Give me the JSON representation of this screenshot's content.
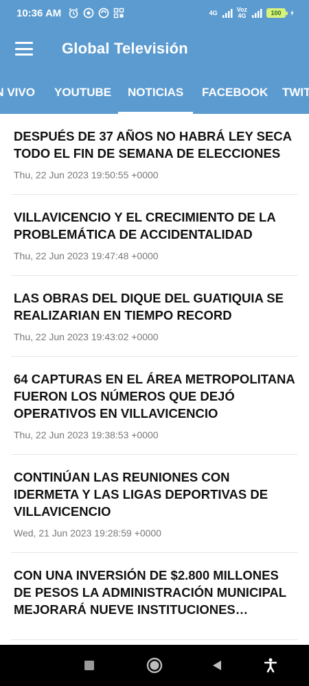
{
  "status_bar": {
    "time": "10:36 AM",
    "network_label_top": "Voz",
    "network_label_bottom": "4G",
    "signal_label": "4G",
    "battery": "100"
  },
  "app_bar": {
    "title": "Global Televisión"
  },
  "tabs": [
    {
      "label": "EN VIVO"
    },
    {
      "label": "YOUTUBE"
    },
    {
      "label": "NOTICIAS",
      "active": true
    },
    {
      "label": "FACEBOOK"
    },
    {
      "label": "TWITTER"
    }
  ],
  "news": [
    {
      "title": "DESPUÉS DE 37 AÑOS NO HABRÁ LEY SECA TODO EL FIN DE SEMANA DE ELECCIONES",
      "date": "Thu, 22 Jun 2023 19:50:55 +0000"
    },
    {
      "title": "VILLAVICENCIO Y EL CRECIMIENTO DE LA PROBLEMÁTICA DE ACCIDENTALIDAD",
      "date": "Thu, 22 Jun 2023 19:47:48 +0000"
    },
    {
      "title": "LAS OBRAS DEL DIQUE DEL GUATIQUIA SE REALIZARIAN  EN TIEMPO RECORD",
      "date": "Thu, 22 Jun 2023 19:43:02 +0000"
    },
    {
      "title": "64 CAPTURAS EN EL ÁREA METROPOLITANA FUERON LOS NÚMEROS QUE DEJÓ OPERATIVOS EN VILLAVICENCIO",
      "date": "Thu, 22 Jun 2023 19:38:53 +0000"
    },
    {
      "title": "CONTINÚAN LAS REUNIONES CON IDERMETA Y LAS LIGAS DEPORTIVAS DE VILLAVICENCIO",
      "date": "Wed, 21 Jun 2023 19:28:59 +0000"
    },
    {
      "title": "CON UNA INVERSIÓN DE $2.800 MILLONES DE PESOS LA ADMINISTRACIÓN MUNICIPAL MEJORARÁ NUEVE INSTITUCIONES EDUCATIVAS",
      "date": ""
    }
  ],
  "icons": {
    "menu": "hamburger-icon",
    "nav_recents": "square-icon",
    "nav_home": "circle-icon",
    "nav_back": "triangle-back-icon",
    "nav_accessibility": "accessibility-icon"
  },
  "colors": {
    "primary": "#5b9bd0",
    "nav_bar": "#000000"
  }
}
